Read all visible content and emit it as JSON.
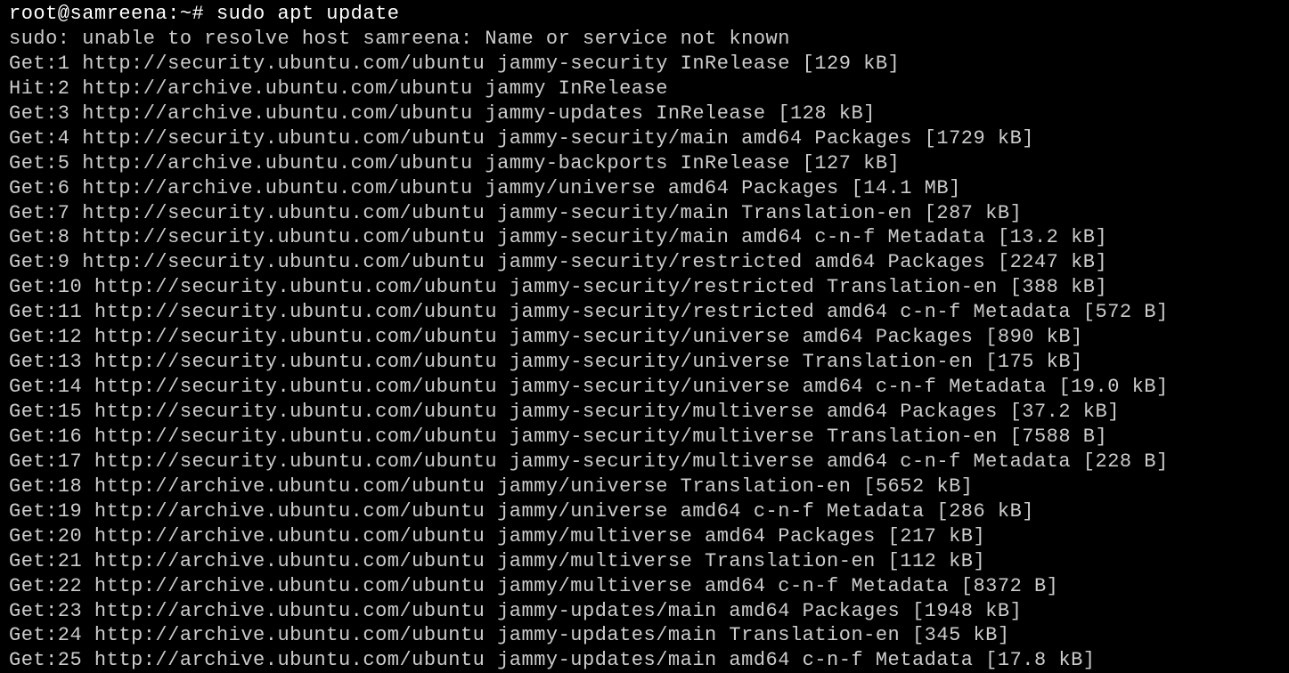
{
  "prompt": "root@samreena:~# ",
  "command": "sudo apt update",
  "lines": [
    "sudo: unable to resolve host samreena: Name or service not known",
    "Get:1 http://security.ubuntu.com/ubuntu jammy-security InRelease [129 kB]",
    "Hit:2 http://archive.ubuntu.com/ubuntu jammy InRelease",
    "Get:3 http://archive.ubuntu.com/ubuntu jammy-updates InRelease [128 kB]",
    "Get:4 http://security.ubuntu.com/ubuntu jammy-security/main amd64 Packages [1729 kB]",
    "Get:5 http://archive.ubuntu.com/ubuntu jammy-backports InRelease [127 kB]",
    "Get:6 http://archive.ubuntu.com/ubuntu jammy/universe amd64 Packages [14.1 MB]",
    "Get:7 http://security.ubuntu.com/ubuntu jammy-security/main Translation-en [287 kB]",
    "Get:8 http://security.ubuntu.com/ubuntu jammy-security/main amd64 c-n-f Metadata [13.2 kB]",
    "Get:9 http://security.ubuntu.com/ubuntu jammy-security/restricted amd64 Packages [2247 kB]",
    "Get:10 http://security.ubuntu.com/ubuntu jammy-security/restricted Translation-en [388 kB]",
    "Get:11 http://security.ubuntu.com/ubuntu jammy-security/restricted amd64 c-n-f Metadata [572 B]",
    "Get:12 http://security.ubuntu.com/ubuntu jammy-security/universe amd64 Packages [890 kB]",
    "Get:13 http://security.ubuntu.com/ubuntu jammy-security/universe Translation-en [175 kB]",
    "Get:14 http://security.ubuntu.com/ubuntu jammy-security/universe amd64 c-n-f Metadata [19.0 kB]",
    "Get:15 http://security.ubuntu.com/ubuntu jammy-security/multiverse amd64 Packages [37.2 kB]",
    "Get:16 http://security.ubuntu.com/ubuntu jammy-security/multiverse Translation-en [7588 B]",
    "Get:17 http://security.ubuntu.com/ubuntu jammy-security/multiverse amd64 c-n-f Metadata [228 B]",
    "Get:18 http://archive.ubuntu.com/ubuntu jammy/universe Translation-en [5652 kB]",
    "Get:19 http://archive.ubuntu.com/ubuntu jammy/universe amd64 c-n-f Metadata [286 kB]",
    "Get:20 http://archive.ubuntu.com/ubuntu jammy/multiverse amd64 Packages [217 kB]",
    "Get:21 http://archive.ubuntu.com/ubuntu jammy/multiverse Translation-en [112 kB]",
    "Get:22 http://archive.ubuntu.com/ubuntu jammy/multiverse amd64 c-n-f Metadata [8372 B]",
    "Get:23 http://archive.ubuntu.com/ubuntu jammy-updates/main amd64 Packages [1948 kB]",
    "Get:24 http://archive.ubuntu.com/ubuntu jammy-updates/main Translation-en [345 kB]",
    "Get:25 http://archive.ubuntu.com/ubuntu jammy-updates/main amd64 c-n-f Metadata [17.8 kB]"
  ]
}
